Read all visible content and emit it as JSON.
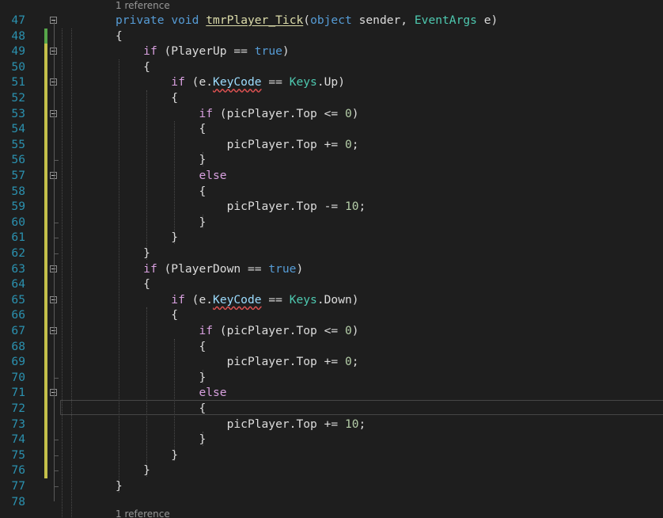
{
  "colors": {
    "background": "#1e1e1e",
    "line_number": "#2b91af",
    "keyword": "#569cd6",
    "control_keyword": "#d8a0df",
    "type": "#4ec9b0",
    "method": "#dcdcaa",
    "number": "#b5cea8",
    "parameter": "#9cdcfe",
    "text": "#dcdcdc",
    "change_saved": "#57a64a",
    "change_unsaved": "#c4c04a"
  },
  "icons": {
    "fold": "collapse-minus-icon"
  },
  "codelens": {
    "top": "1 reference",
    "bottom": "1 reference"
  },
  "current_line_number": "72",
  "lines": [
    {
      "n": "47",
      "indent": "",
      "tokens": [
        [
          "kw",
          "private"
        ],
        [
          "id",
          " "
        ],
        [
          "kw",
          "void"
        ],
        [
          "id",
          " "
        ],
        [
          "mt",
          "tmrPlayer_Tick"
        ],
        [
          "id",
          "("
        ],
        [
          "kw",
          "object"
        ],
        [
          "id",
          " sender, "
        ],
        [
          "tp",
          "EventArgs"
        ],
        [
          "id",
          " e)"
        ]
      ],
      "fold": true
    },
    {
      "n": "48",
      "indent": "",
      "tokens": [
        [
          "id",
          "{"
        ]
      ],
      "fold": false
    },
    {
      "n": "49",
      "indent": "    ",
      "tokens": [
        [
          "ctl",
          "if"
        ],
        [
          "id",
          " (PlayerUp == "
        ],
        [
          "kw",
          "true"
        ],
        [
          "id",
          ")"
        ]
      ],
      "fold": true
    },
    {
      "n": "50",
      "indent": "    ",
      "tokens": [
        [
          "id",
          "{"
        ]
      ],
      "fold": false
    },
    {
      "n": "51",
      "indent": "        ",
      "tokens": [
        [
          "ctl",
          "if"
        ],
        [
          "id",
          " (e."
        ],
        [
          "sq",
          "KeyCode"
        ],
        [
          "id",
          " == "
        ],
        [
          "tp",
          "Keys"
        ],
        [
          "id",
          ".Up)"
        ]
      ],
      "fold": true
    },
    {
      "n": "52",
      "indent": "        ",
      "tokens": [
        [
          "id",
          "{"
        ]
      ],
      "fold": false
    },
    {
      "n": "53",
      "indent": "            ",
      "tokens": [
        [
          "ctl",
          "if"
        ],
        [
          "id",
          " (picPlayer.Top <= "
        ],
        [
          "num",
          "0"
        ],
        [
          "id",
          ")"
        ]
      ],
      "fold": true
    },
    {
      "n": "54",
      "indent": "            ",
      "tokens": [
        [
          "id",
          "{"
        ]
      ],
      "fold": false
    },
    {
      "n": "55",
      "indent": "                ",
      "tokens": [
        [
          "id",
          "picPlayer.Top += "
        ],
        [
          "num",
          "0"
        ],
        [
          "id",
          ";"
        ]
      ],
      "fold": false
    },
    {
      "n": "56",
      "indent": "            ",
      "tokens": [
        [
          "id",
          "}"
        ]
      ],
      "fold": false
    },
    {
      "n": "57",
      "indent": "            ",
      "tokens": [
        [
          "ctl",
          "else"
        ]
      ],
      "fold": true
    },
    {
      "n": "58",
      "indent": "            ",
      "tokens": [
        [
          "id",
          "{"
        ]
      ],
      "fold": false
    },
    {
      "n": "59",
      "indent": "                ",
      "tokens": [
        [
          "id",
          "picPlayer.Top -= "
        ],
        [
          "num",
          "10"
        ],
        [
          "id",
          ";"
        ]
      ],
      "fold": false
    },
    {
      "n": "60",
      "indent": "            ",
      "tokens": [
        [
          "id",
          "}"
        ]
      ],
      "fold": false
    },
    {
      "n": "61",
      "indent": "        ",
      "tokens": [
        [
          "id",
          "}"
        ]
      ],
      "fold": false
    },
    {
      "n": "62",
      "indent": "    ",
      "tokens": [
        [
          "id",
          "}"
        ]
      ],
      "fold": false
    },
    {
      "n": "63",
      "indent": "    ",
      "tokens": [
        [
          "ctl",
          "if"
        ],
        [
          "id",
          " (PlayerDown == "
        ],
        [
          "kw",
          "true"
        ],
        [
          "id",
          ")"
        ]
      ],
      "fold": true
    },
    {
      "n": "64",
      "indent": "    ",
      "tokens": [
        [
          "id",
          "{"
        ]
      ],
      "fold": false
    },
    {
      "n": "65",
      "indent": "        ",
      "tokens": [
        [
          "ctl",
          "if"
        ],
        [
          "id",
          " (e."
        ],
        [
          "sq",
          "KeyCode"
        ],
        [
          "id",
          " == "
        ],
        [
          "tp",
          "Keys"
        ],
        [
          "id",
          ".Down)"
        ]
      ],
      "fold": true
    },
    {
      "n": "66",
      "indent": "        ",
      "tokens": [
        [
          "id",
          "{"
        ]
      ],
      "fold": false
    },
    {
      "n": "67",
      "indent": "            ",
      "tokens": [
        [
          "ctl",
          "if"
        ],
        [
          "id",
          " (picPlayer.Top <= "
        ],
        [
          "num",
          "0"
        ],
        [
          "id",
          ")"
        ]
      ],
      "fold": true
    },
    {
      "n": "68",
      "indent": "            ",
      "tokens": [
        [
          "id",
          "{"
        ]
      ],
      "fold": false
    },
    {
      "n": "69",
      "indent": "                ",
      "tokens": [
        [
          "id",
          "picPlayer.Top += "
        ],
        [
          "num",
          "0"
        ],
        [
          "id",
          ";"
        ]
      ],
      "fold": false
    },
    {
      "n": "70",
      "indent": "            ",
      "tokens": [
        [
          "id",
          "}"
        ]
      ],
      "fold": false
    },
    {
      "n": "71",
      "indent": "            ",
      "tokens": [
        [
          "ctl",
          "else"
        ]
      ],
      "fold": true
    },
    {
      "n": "72",
      "indent": "            ",
      "tokens": [
        [
          "id",
          "{"
        ]
      ],
      "fold": false
    },
    {
      "n": "73",
      "indent": "                ",
      "tokens": [
        [
          "id",
          "picPlayer.Top += "
        ],
        [
          "num",
          "10"
        ],
        [
          "id",
          ";"
        ]
      ],
      "fold": false
    },
    {
      "n": "74",
      "indent": "            ",
      "tokens": [
        [
          "id",
          "}"
        ]
      ],
      "fold": false
    },
    {
      "n": "75",
      "indent": "        ",
      "tokens": [
        [
          "id",
          "}"
        ]
      ],
      "fold": false
    },
    {
      "n": "76",
      "indent": "    ",
      "tokens": [
        [
          "id",
          "}"
        ]
      ],
      "fold": false
    },
    {
      "n": "77",
      "indent": "",
      "tokens": [
        [
          "id",
          "}"
        ]
      ],
      "fold": false
    },
    {
      "n": "78",
      "indent": "",
      "tokens": [],
      "fold": false
    }
  ]
}
